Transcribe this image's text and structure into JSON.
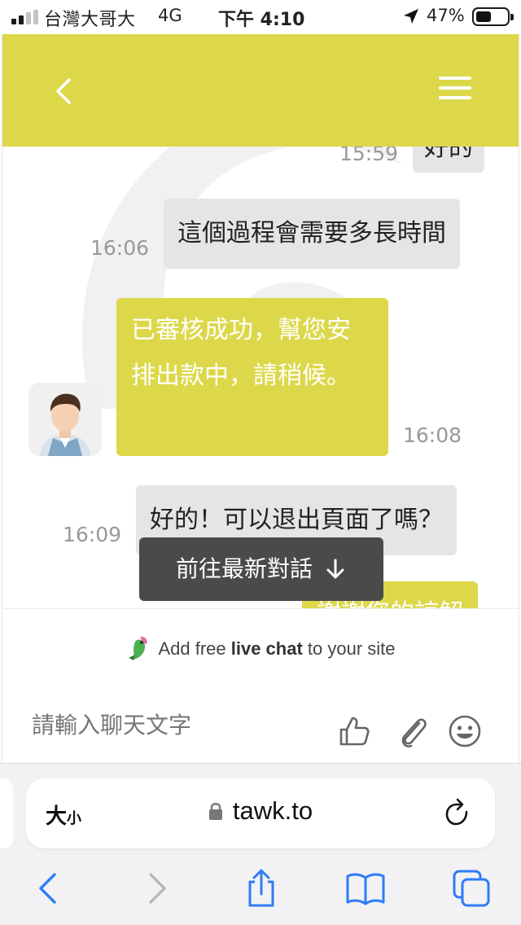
{
  "status_bar": {
    "carrier": "台灣大哥大",
    "network": "4G",
    "time": "下午 4:10",
    "battery": "47%",
    "battery_level": 0.47
  },
  "chat": {
    "header": {
      "color": "#dcd84a"
    },
    "messages": [
      {
        "from": "visitor",
        "text": "好的",
        "time": "15:59"
      },
      {
        "from": "visitor",
        "text": "這個過程會需要多長時間",
        "time": "16:06"
      },
      {
        "from": "agent",
        "text": "已審核成功，幫您安排出款中，請稍候。",
        "time": "16:08"
      },
      {
        "from": "visitor",
        "text": "好的！可以退出頁面了嗎？",
        "time": "16:09"
      },
      {
        "from": "agent",
        "text": "謝謝您的諒解"
      }
    ],
    "jump_button": "前往最新對話",
    "promo": {
      "prefix": "Add free",
      "bold": "live chat",
      "suffix": "to your site"
    },
    "input_placeholder": "請輸入聊天文字"
  },
  "browser": {
    "text_size_big": "大",
    "text_size_small": "小",
    "url": "tawk.to"
  },
  "colors": {
    "accent": "#dcd84a",
    "bubble_gray": "#e5e5e5",
    "ios_blue": "#2f7cf6"
  },
  "icons": [
    "back-chevron-icon",
    "hamburger-menu-icon",
    "arrow-down-icon",
    "parrot-icon",
    "thumbs-up-icon",
    "paperclip-icon",
    "smiley-icon",
    "lock-icon",
    "reload-icon",
    "share-icon",
    "bookmarks-icon",
    "tabs-icon"
  ]
}
